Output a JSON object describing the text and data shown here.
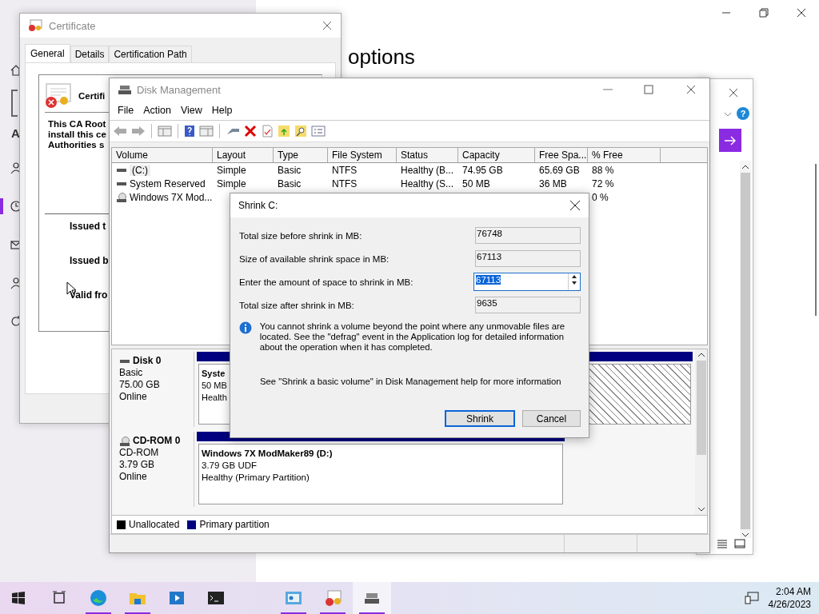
{
  "settings": {
    "heading": "options",
    "sidebar_label": "A",
    "sidebar_items": [
      {
        "kind": "home",
        "selected": false
      },
      {
        "kind": "person",
        "selected": false
      },
      {
        "kind": "clock",
        "selected": true
      },
      {
        "kind": "mail",
        "selected": false
      },
      {
        "kind": "person",
        "selected": false
      },
      {
        "kind": "sync",
        "selected": false
      }
    ],
    "help_glyph": "?"
  },
  "certificate": {
    "title": "Certificate",
    "tabs": [
      {
        "label": "General",
        "selected": true
      },
      {
        "label": "Details",
        "selected": false
      },
      {
        "label": "Certification Path",
        "selected": false
      }
    ],
    "header": "Certifi",
    "description": [
      "This CA Root",
      "install this ce",
      "Authorities s"
    ],
    "fields": [
      "Issued t",
      "Issued b",
      "Valid fro"
    ]
  },
  "disk_management": {
    "title": "Disk Management",
    "menu": [
      "File",
      "Action",
      "View",
      "Help"
    ],
    "columns": [
      "Volume",
      "Layout",
      "Type",
      "File System",
      "Status",
      "Capacity",
      "Free Spa...",
      "% Free"
    ],
    "rows": [
      {
        "kind": "disk",
        "volume": "(C:)",
        "layout": "Simple",
        "type": "Basic",
        "file_system": "NTFS",
        "status": "Healthy (B...",
        "capacity": "74.95 GB",
        "free_space": "65.69 GB",
        "percent_free": "88 %",
        "selected": true
      },
      {
        "kind": "disk",
        "volume": "System Reserved",
        "layout": "Simple",
        "type": "Basic",
        "file_system": "NTFS",
        "status": "Healthy (S...",
        "capacity": "50 MB",
        "free_space": "36 MB",
        "percent_free": "72 %",
        "selected": false
      },
      {
        "kind": "cdrom",
        "volume": "Windows 7X Mod...",
        "percent_free": "0 %",
        "selected": false
      }
    ],
    "disks": [
      {
        "kind": "disk",
        "name": "Disk 0",
        "lines": [
          "Basic",
          "75.00 GB",
          "Online"
        ],
        "partitions": [
          {
            "kind": "primary",
            "lines": [
              "Syste",
              "50 MB",
              "Health"
            ]
          },
          {
            "kind": "unallocated"
          }
        ]
      },
      {
        "kind": "cdrom",
        "name": "CD-ROM 0",
        "lines": [
          "CD-ROM",
          "3.79 GB",
          "Online"
        ],
        "partitions": [
          {
            "kind": "primary",
            "lines": [
              "Windows 7X ModMaker89  (D:)",
              "3.79 GB UDF",
              "Healthy (Primary Partition)"
            ]
          }
        ]
      }
    ],
    "legend": [
      {
        "label": "Unallocated",
        "color": "#000000"
      },
      {
        "label": "Primary partition",
        "color": "#000080"
      }
    ]
  },
  "shrink_dialog": {
    "title": "Shrink C:",
    "fields": [
      {
        "kind": "readonly",
        "label": "Total size before shrink in MB:",
        "value": "76748"
      },
      {
        "kind": "readonly",
        "label": "Size of available shrink space in MB:",
        "value": "67113"
      },
      {
        "kind": "spin",
        "label": "Enter the amount of space to shrink in MB:",
        "value": "67113"
      },
      {
        "kind": "readonly",
        "label": "Total size after shrink in MB:",
        "value": "9635"
      }
    ],
    "info": "You cannot shrink a volume beyond the point where any unmovable files are located. See the \"defrag\" event in the Application log for detailed information about the operation when it has completed.",
    "help": "See \"Shrink a basic volume\" in Disk Management help for more information",
    "buttons": [
      {
        "label": "Shrink",
        "default": true
      },
      {
        "label": "Cancel",
        "default": false
      }
    ]
  },
  "taskbar": {
    "apps": [
      {
        "kind": "taskview",
        "running": false,
        "selected": false
      },
      {
        "kind": "edge",
        "running": true,
        "selected": false
      },
      {
        "kind": "explorer",
        "running": true,
        "selected": false
      },
      {
        "kind": "media",
        "running": false,
        "selected": false
      },
      {
        "kind": "terminal",
        "running": false,
        "selected": false
      },
      {
        "kind": "control",
        "running": true,
        "selected": false
      },
      {
        "kind": "certificate",
        "running": true,
        "selected": false
      },
      {
        "kind": "diskmgmt",
        "running": true,
        "selected": true
      }
    ],
    "time": "2:04 AM",
    "date": "4/26/2023"
  }
}
